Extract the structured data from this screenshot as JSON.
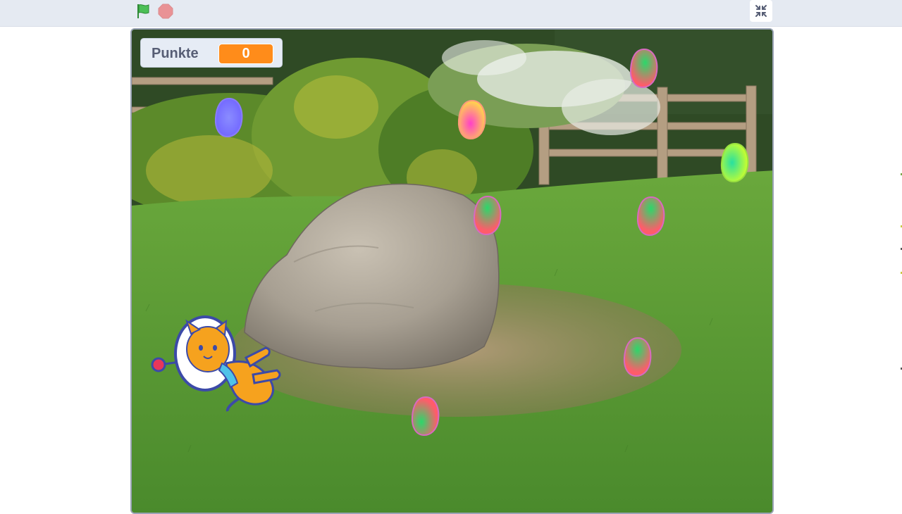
{
  "toolbar": {
    "flag_icon": "green-flag-icon",
    "stop_icon": "stop-icon",
    "fullscreen_icon": "unfullscreen-icon",
    "flag_color": "#0fbd8c",
    "stop_color": "#ec5959"
  },
  "stage": {
    "monitor": {
      "label": "Punkte",
      "value": "0",
      "value_color": "#ff8c1a"
    },
    "sprites": {
      "player": "astronaut-cat-sprite",
      "collectibles": "color-blob-sprite"
    }
  }
}
